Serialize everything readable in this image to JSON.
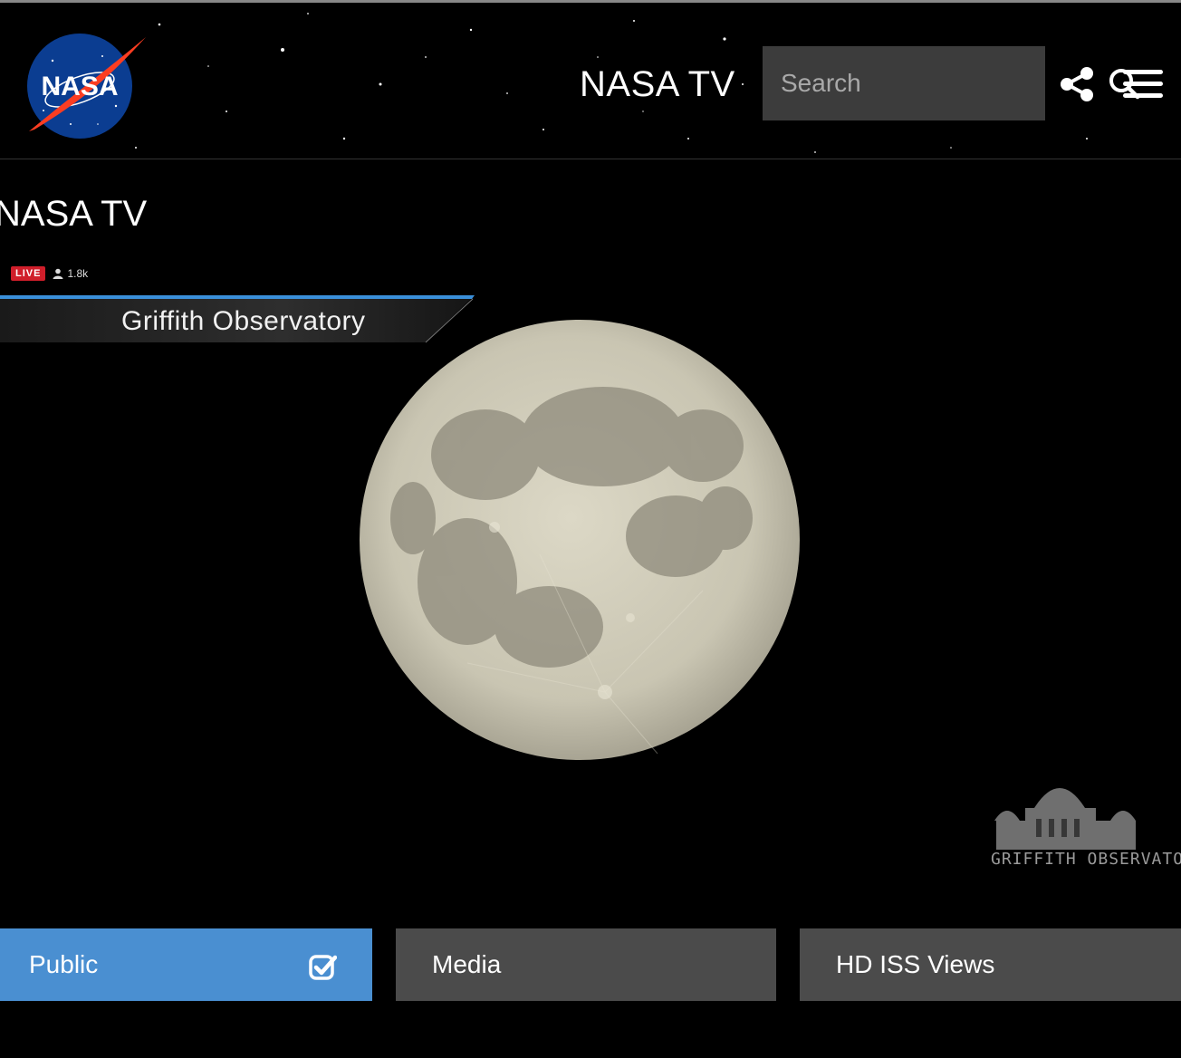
{
  "header": {
    "logo_text": "NASA",
    "title": "NASA TV",
    "search": {
      "placeholder": "Search",
      "value": ""
    },
    "icons": [
      "search-icon",
      "share-icon",
      "menu-icon"
    ]
  },
  "page": {
    "title": "NASA TV"
  },
  "player": {
    "live_label": "LIVE",
    "viewer_count": "1.8k",
    "banner_text": "Griffith Observatory",
    "watermark_text": "GRIFFITH OBSERVATORY"
  },
  "tabs": [
    {
      "label": "Public",
      "selected": true
    },
    {
      "label": "Media",
      "selected": false
    },
    {
      "label": "HD ISS Views",
      "selected": false
    }
  ],
  "colors": {
    "background": "#000000",
    "tab_selected": "#4a8fd1",
    "tab_default": "#4b4b4b",
    "search_bg": "#3c3c3c",
    "live_red": "#d01e2a",
    "banner_blue": "#3a8fd9"
  }
}
